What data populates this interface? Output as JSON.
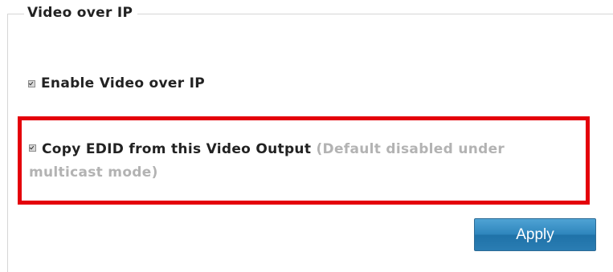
{
  "section": {
    "title": "Video over IP"
  },
  "options": {
    "enable_video_over_ip": {
      "label": "Enable Video over IP",
      "checked": true
    },
    "copy_edid": {
      "label": "Copy EDID from this Video Output",
      "note": "(Default disabled under multicast mode)",
      "checked": true
    }
  },
  "buttons": {
    "apply_label": "Apply"
  },
  "colors": {
    "highlight_border": "#e4000b",
    "apply_button": "#2f86bd",
    "note_text": "#b3b3b3"
  }
}
